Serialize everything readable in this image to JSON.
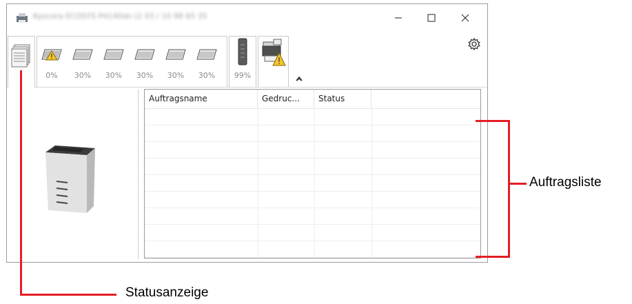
{
  "window": {
    "title": "Kyocera ECOSYS P4140dn (2 03 / 10 98 65 35",
    "controls": {
      "minimize_icon": "minimize-icon",
      "maximize_icon": "maximize-icon",
      "close_icon": "close-icon"
    }
  },
  "toolbar": {
    "status_tab_icon": "document-stack-icon",
    "trays": [
      {
        "level": "0%",
        "warning": true
      },
      {
        "level": "30%",
        "warning": false
      },
      {
        "level": "30%",
        "warning": false
      },
      {
        "level": "30%",
        "warning": false
      },
      {
        "level": "30%",
        "warning": false
      },
      {
        "level": "30%",
        "warning": false
      }
    ],
    "toner": {
      "level": "99%"
    },
    "device_icon": "printer-warning-icon",
    "settings_icon": "gear-icon",
    "collapse_icon": "chevron-up-icon"
  },
  "job_list": {
    "columns": [
      "Auftragsname",
      "Gedruc...",
      "Status",
      ""
    ],
    "rows": 9
  },
  "annotations": {
    "job_list_label": "Auftragsliste",
    "status_label": "Statusanzeige"
  },
  "colors": {
    "annotation": "#e31e24",
    "warning": "#f4c430"
  }
}
